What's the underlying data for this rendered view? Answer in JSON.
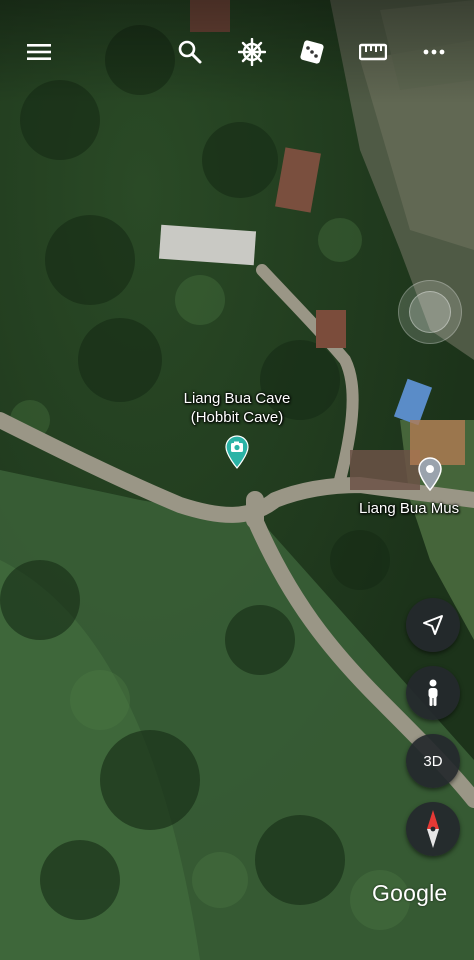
{
  "toolbar": {
    "menu_icon": "hamburger-menu-icon",
    "search_icon": "search-icon",
    "voyager_icon": "ship-wheel-icon",
    "feeling_lucky_icon": "dice-icon",
    "measure_icon": "ruler-icon",
    "more_icon": "more-vertical-dots-icon"
  },
  "places": [
    {
      "name_line1": "Liang Bua Cave",
      "name_line2": "(Hobbit Cave)",
      "icon": "camera-pin-icon",
      "color": "#2bb3a6"
    },
    {
      "name": "Liang Bua Mus",
      "icon": "map-pin-icon",
      "color": "#9aa3ad"
    }
  ],
  "controls": {
    "joystick_icon": "pan-joystick-icon",
    "my_location_icon": "navigation-arrow-icon",
    "pegman_icon": "pegman-icon",
    "view_3d_label": "3D",
    "compass_icon": "compass-icon"
  },
  "attribution": "Google",
  "colors": {
    "forest_dark": "#1f3a1d",
    "forest_mid": "#35573a",
    "road": "#9a9686",
    "control_bg": "#24282c",
    "place_teal": "#2bb3a6",
    "compass_red": "#e53935"
  }
}
